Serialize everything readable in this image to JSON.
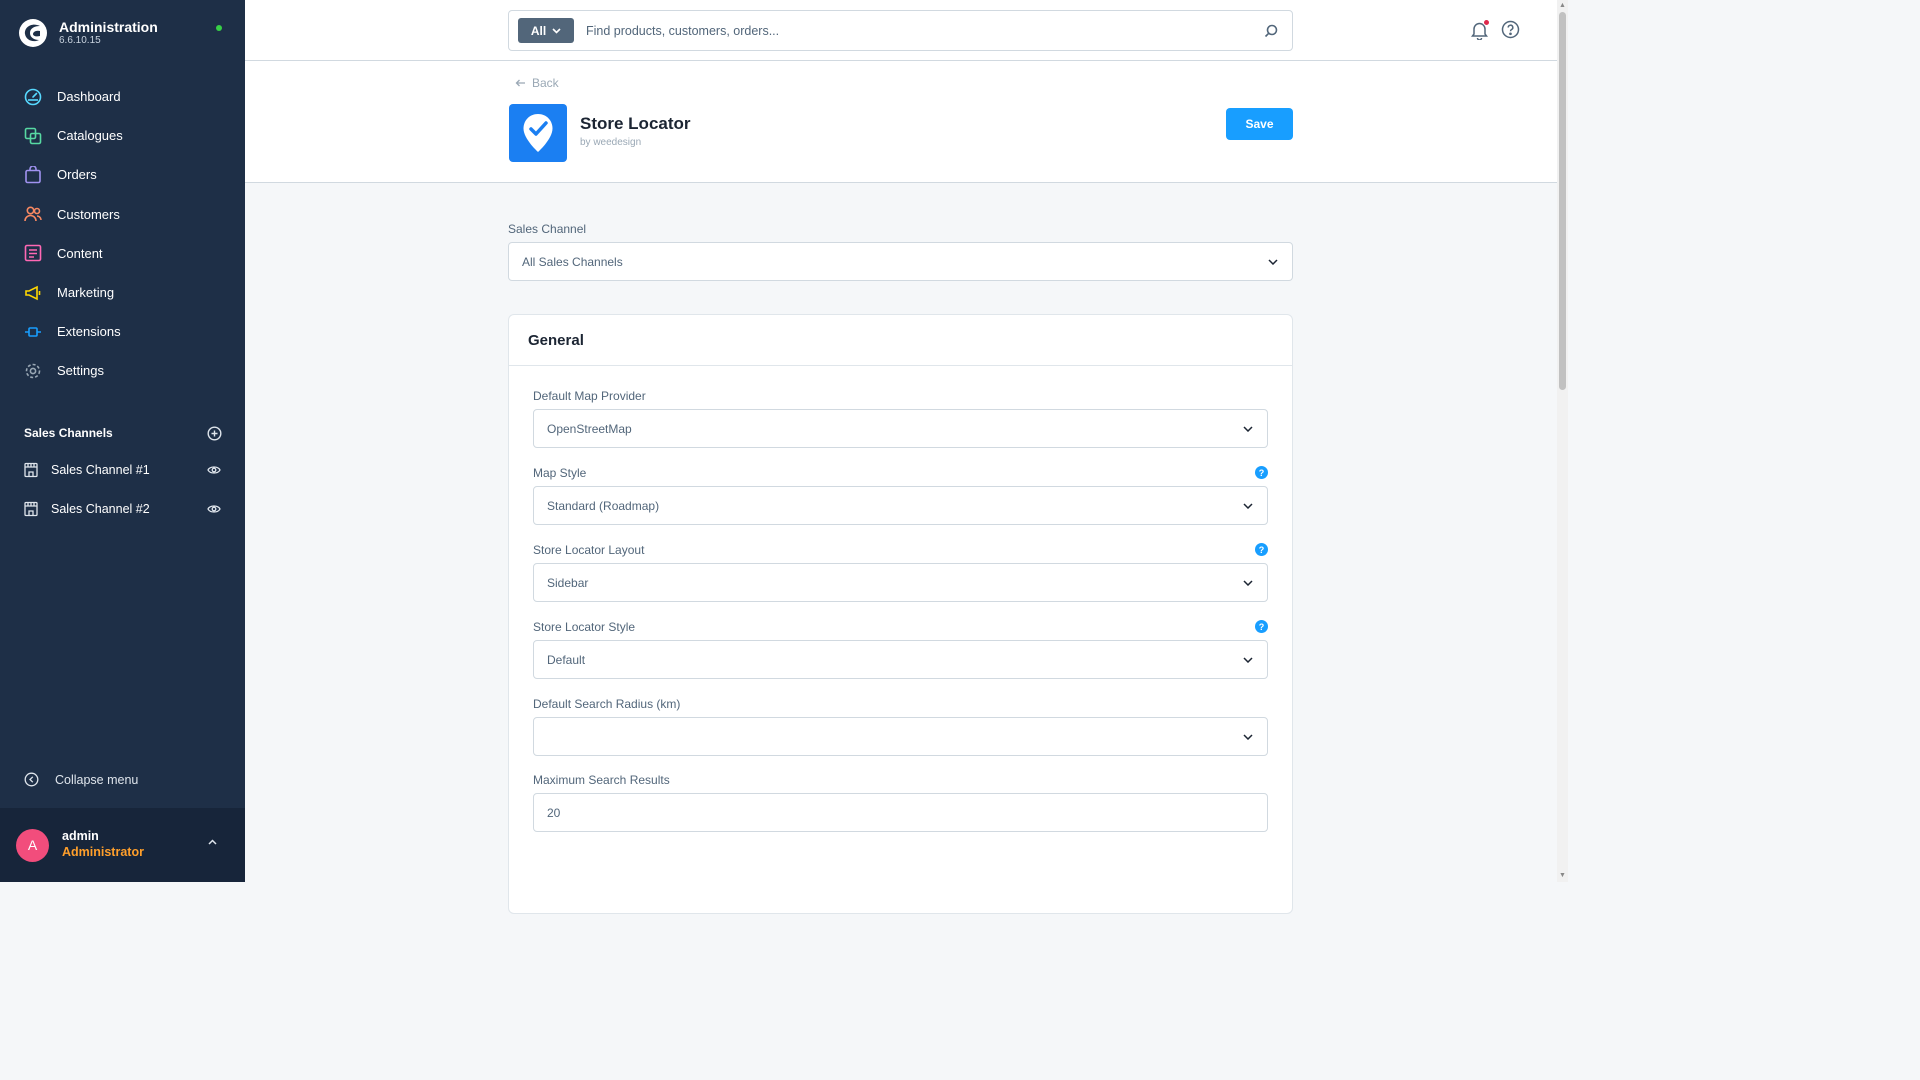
{
  "sidebar": {
    "brand_title": "Administration",
    "version": "6.6.10.15",
    "nav": [
      {
        "label": "Dashboard",
        "icon": "dashboard-icon",
        "color": "#57d9ff"
      },
      {
        "label": "Catalogues",
        "icon": "catalogues-icon",
        "color": "#57d9a3"
      },
      {
        "label": "Orders",
        "icon": "orders-icon",
        "color": "#a092f0"
      },
      {
        "label": "Customers",
        "icon": "customers-icon",
        "color": "#f88962"
      },
      {
        "label": "Content",
        "icon": "content-icon",
        "color": "#ff68b4"
      },
      {
        "label": "Marketing",
        "icon": "marketing-icon",
        "color": "#ffd700"
      },
      {
        "label": "Extensions",
        "icon": "extensions-icon",
        "color": "#189eff"
      },
      {
        "label": "Settings",
        "icon": "settings-icon",
        "color": "#9aa8b5"
      }
    ],
    "sales_channels_title": "Sales Channels",
    "sales_channels": [
      {
        "label": "Sales Channel #1"
      },
      {
        "label": "Sales Channel #2"
      }
    ],
    "collapse_label": "Collapse menu",
    "user": {
      "initial": "A",
      "name": "admin",
      "role": "Administrator"
    }
  },
  "topbar": {
    "search_type": "All",
    "search_placeholder": "Find products, customers, orders..."
  },
  "header": {
    "back_label": "Back",
    "app_title": "Store Locator",
    "app_by": "by weedesign",
    "save_label": "Save"
  },
  "sales_channel": {
    "label": "Sales Channel",
    "value": "All Sales Channels"
  },
  "general": {
    "title": "General",
    "fields": [
      {
        "label": "Default Map Provider",
        "value": "OpenStreetMap",
        "type": "select",
        "help": false
      },
      {
        "label": "Map Style",
        "value": "Standard (Roadmap)",
        "type": "select",
        "help": true
      },
      {
        "label": "Store Locator Layout",
        "value": "Sidebar",
        "type": "select",
        "help": true
      },
      {
        "label": "Store Locator Style",
        "value": "Default",
        "type": "select",
        "help": true
      },
      {
        "label": "Default Search Radius (km)",
        "value": "",
        "type": "select",
        "help": false
      },
      {
        "label": "Maximum Search Results",
        "value": "20",
        "type": "input",
        "help": false
      }
    ]
  },
  "colors": {
    "sidebar_bg": "#1e2f47",
    "accent": "#189eff",
    "app_icon_bg": "#1b7ff2",
    "role_color": "#ff9f2b",
    "avatar_bg": "#f24d7c"
  }
}
